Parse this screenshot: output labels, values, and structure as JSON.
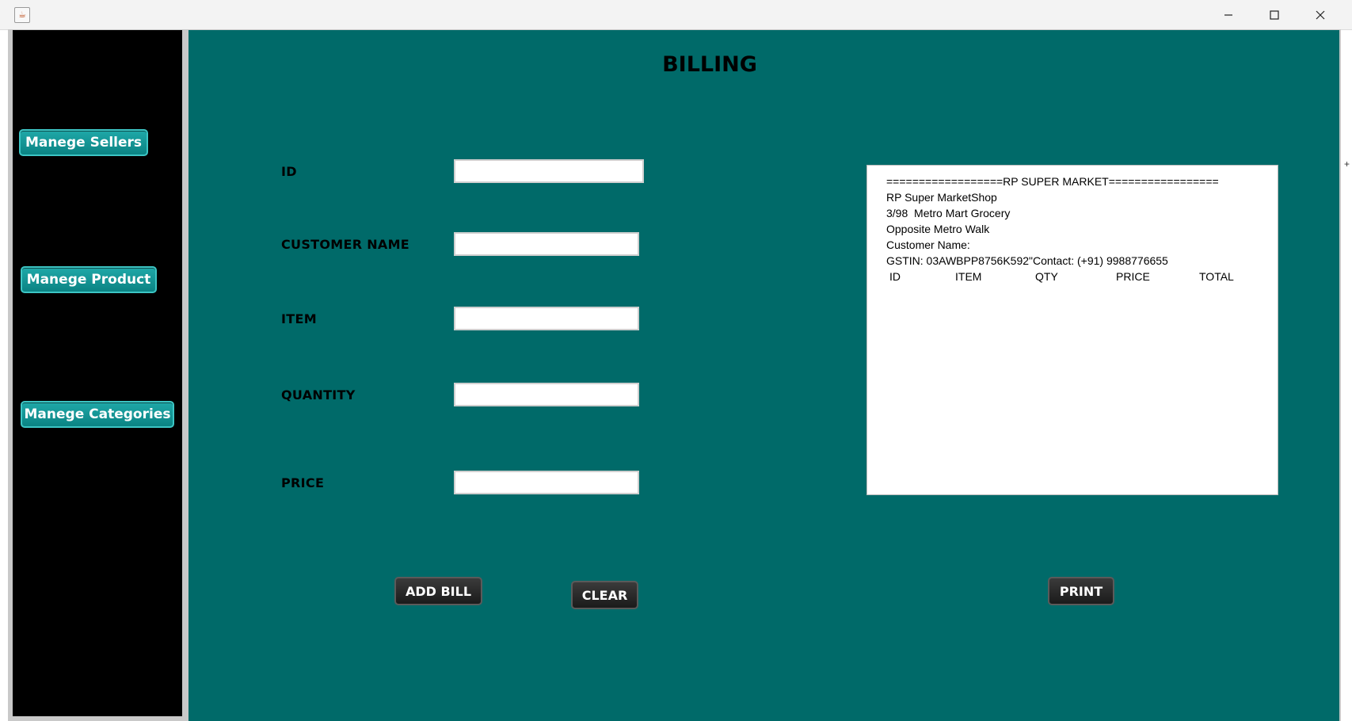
{
  "window": {
    "icon": "java-cup-icon",
    "controls": {
      "minimize": "minimize-icon",
      "maximize": "maximize-icon",
      "close": "close-icon"
    }
  },
  "sidebar": {
    "buttons": [
      "Manege Sellers",
      "Manege Product",
      "Manege Categories"
    ]
  },
  "page": {
    "title": "BILLING"
  },
  "form": {
    "id_label": "ID",
    "id_value": "",
    "customer_label": "CUSTOMER NAME",
    "customer_value": "",
    "item_label": "ITEM",
    "item_value": "",
    "quantity_label": "QUANTITY",
    "quantity_value": "",
    "price_label": "PRICE",
    "price_value": ""
  },
  "buttons": {
    "add_bill": "ADD BILL",
    "clear": "CLEAR",
    "print": "PRINT"
  },
  "receipt": {
    "lines": [
      "==================RP SUPER MARKET=================",
      "RP Super MarketShop",
      "3/98  Metro Mart Grocery",
      "Opposite Metro Walk",
      "Customer Name:",
      "GSTIN: 03AWBPP8756K592\"Contact: (+91) 9988776655"
    ],
    "columns": [
      "ID",
      "ITEM",
      "QTY",
      "PRICE",
      "TOTAL"
    ]
  },
  "colors": {
    "main_bg": "#006a69",
    "sidebar_bg": "#000000",
    "side_button": "#0f9090",
    "dark_button": "#2a2a2a"
  }
}
